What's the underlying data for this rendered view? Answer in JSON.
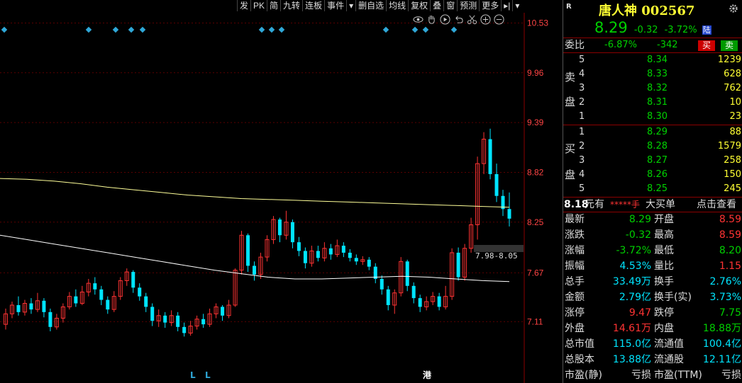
{
  "toolbar": {
    "items": [
      "发",
      "PK",
      "简",
      "九转",
      "连板",
      "事件",
      "▾",
      "删自选",
      "均线",
      "复权",
      "叠",
      "窗",
      "预测",
      "更多",
      "▸|",
      "▾"
    ],
    "icons": [
      "eye-icon",
      "hand-icon",
      "play-icon",
      "undo-icon",
      "scissors-icon",
      "zoom-in-icon",
      "zoom-out-icon"
    ]
  },
  "chart": {
    "y_ticks": [
      "10.53",
      "9.96",
      "9.39",
      "8.82",
      "8.25",
      "7.67",
      "7.11"
    ],
    "range_label": "7.98-8.05",
    "bottom_markers": [
      "L",
      "L",
      "港"
    ]
  },
  "chart_data": {
    "type": "candlestick",
    "ylim": [
      6.7,
      10.55
    ],
    "up_color": "#ff3333",
    "down_color": "#00e5ff",
    "ma_color": "#ffff99",
    "ma2_color": "#ffffff",
    "candles": [
      [
        7.08,
        7.2,
        7.26,
        7.02
      ],
      [
        7.2,
        7.3,
        7.34,
        7.15
      ],
      [
        7.3,
        7.22,
        7.4,
        7.18
      ],
      [
        7.22,
        7.32,
        7.36,
        7.18
      ],
      [
        7.32,
        7.25,
        7.38,
        7.2
      ],
      [
        7.25,
        7.35,
        7.44,
        7.22
      ],
      [
        7.35,
        7.22,
        7.38,
        7.16
      ],
      [
        7.22,
        7.05,
        7.26,
        7.0
      ],
      [
        7.05,
        7.15,
        7.2,
        7.02
      ],
      [
        7.15,
        7.28,
        7.32,
        7.1
      ],
      [
        7.28,
        7.4,
        7.45,
        7.25
      ],
      [
        7.4,
        7.32,
        7.48,
        7.28
      ],
      [
        7.32,
        7.45,
        7.52,
        7.3
      ],
      [
        7.45,
        7.55,
        7.6,
        7.4
      ],
      [
        7.55,
        7.48,
        7.62,
        7.42
      ],
      [
        7.48,
        7.36,
        7.52,
        7.3
      ],
      [
        7.36,
        7.25,
        7.4,
        7.2
      ],
      [
        7.25,
        7.4,
        7.46,
        7.22
      ],
      [
        7.4,
        7.58,
        7.62,
        7.36
      ],
      [
        7.58,
        7.68,
        7.72,
        7.52
      ],
      [
        7.68,
        7.5,
        7.7,
        7.44
      ],
      [
        7.5,
        7.4,
        7.55,
        7.35
      ],
      [
        7.4,
        7.28,
        7.44,
        7.22
      ],
      [
        7.28,
        7.12,
        7.32,
        7.06
      ],
      [
        7.12,
        7.18,
        7.25,
        7.05
      ],
      [
        7.18,
        7.1,
        7.22,
        7.04
      ],
      [
        7.1,
        7.18,
        7.24,
        7.06
      ],
      [
        7.18,
        7.05,
        7.22,
        7.0
      ],
      [
        7.05,
        6.98,
        7.1,
        6.94
      ],
      [
        6.98,
        7.06,
        7.12,
        6.95
      ],
      [
        7.06,
        7.14,
        7.18,
        7.02
      ],
      [
        7.14,
        7.08,
        7.2,
        7.04
      ],
      [
        7.08,
        7.2,
        7.26,
        7.05
      ],
      [
        7.2,
        7.28,
        7.32,
        7.15
      ],
      [
        7.28,
        7.18,
        7.3,
        7.12
      ],
      [
        7.18,
        7.3,
        7.36,
        7.15
      ],
      [
        7.3,
        7.7,
        7.72,
        7.28
      ],
      [
        7.7,
        8.1,
        8.15,
        7.65
      ],
      [
        8.1,
        7.75,
        8.12,
        7.68
      ],
      [
        7.75,
        7.65,
        7.8,
        7.58
      ],
      [
        7.65,
        7.85,
        7.9,
        7.6
      ],
      [
        7.85,
        8.05,
        8.1,
        7.8
      ],
      [
        8.05,
        8.28,
        8.32,
        8.0
      ],
      [
        8.28,
        8.1,
        8.3,
        8.02
      ],
      [
        8.1,
        8.25,
        8.38,
        8.05
      ],
      [
        8.25,
        8.02,
        8.28,
        7.95
      ],
      [
        8.02,
        7.92,
        8.08,
        7.86
      ],
      [
        7.92,
        7.78,
        7.96,
        7.72
      ],
      [
        7.78,
        7.92,
        7.98,
        7.74
      ],
      [
        7.92,
        7.84,
        7.98,
        7.8
      ],
      [
        7.84,
        7.95,
        8.02,
        7.8
      ],
      [
        7.95,
        7.88,
        8.0,
        7.82
      ],
      [
        7.88,
        7.98,
        8.05,
        7.85
      ],
      [
        7.98,
        7.9,
        8.02,
        7.85
      ],
      [
        7.9,
        7.84,
        7.94,
        7.8
      ],
      [
        7.84,
        7.8,
        7.88,
        7.76
      ],
      [
        7.8,
        7.82,
        7.86,
        7.76
      ],
      [
        7.82,
        7.74,
        7.85,
        7.7
      ],
      [
        7.74,
        7.6,
        7.78,
        7.55
      ],
      [
        7.6,
        7.48,
        7.64,
        7.42
      ],
      [
        7.48,
        7.3,
        7.52,
        7.24
      ],
      [
        7.3,
        7.44,
        7.48,
        7.2
      ],
      [
        7.44,
        7.8,
        7.85,
        7.4
      ],
      [
        7.8,
        7.52,
        7.82,
        7.46
      ],
      [
        7.52,
        7.38,
        7.56,
        7.32
      ],
      [
        7.38,
        7.28,
        7.42,
        7.22
      ],
      [
        7.28,
        7.34,
        7.4,
        7.24
      ],
      [
        7.34,
        7.4,
        7.45,
        7.3
      ],
      [
        7.4,
        7.28,
        7.44,
        7.24
      ],
      [
        7.28,
        7.4,
        7.52,
        7.25
      ],
      [
        7.4,
        7.9,
        7.95,
        7.36
      ],
      [
        7.9,
        7.62,
        7.96,
        7.58
      ],
      [
        7.62,
        7.95,
        8.0,
        7.58
      ],
      [
        7.95,
        8.22,
        8.3,
        7.9
      ],
      [
        8.22,
        8.92,
        9.0,
        8.05
      ],
      [
        8.92,
        9.2,
        9.28,
        8.8
      ],
      [
        9.2,
        8.8,
        9.32,
        8.74
      ],
      [
        8.8,
        8.55,
        8.92,
        8.48
      ],
      [
        8.55,
        8.4,
        8.62,
        8.32
      ],
      [
        8.4,
        8.29,
        8.59,
        8.2
      ]
    ],
    "ma_long": [
      8.75,
      8.74,
      8.72,
      8.69,
      8.65,
      8.62,
      8.59,
      8.56,
      8.54,
      8.52,
      8.51,
      8.5,
      8.49,
      8.48,
      8.47,
      8.46,
      8.45,
      8.44,
      8.43,
      8.42
    ],
    "ma_mid": [
      8.1,
      8.05,
      8.0,
      7.95,
      7.9,
      7.85,
      7.8,
      7.75,
      7.7,
      7.66,
      7.62,
      7.6,
      7.6,
      7.61,
      7.62,
      7.63,
      7.62,
      7.6,
      7.58,
      7.57
    ],
    "ticker_markers_x": [
      6,
      125,
      163,
      185,
      201,
      369,
      383,
      397,
      544,
      585,
      600,
      640
    ]
  },
  "panel": {
    "badge": "R",
    "name_code": "唐人神 002567",
    "price": "8.29",
    "change": "-0.32",
    "change_pct": "-3.72%",
    "market_tag": "陆",
    "weibi_label": "委比",
    "weibi_pct": "-6.87%",
    "weibi_diff": "-342",
    "buy_btn": "买",
    "sell_btn": "卖",
    "sell_label": [
      "卖",
      "盘"
    ],
    "buy_label": [
      "买",
      "盘"
    ],
    "asks": [
      {
        "lvl": "5",
        "price": "8.34",
        "vol": "1239"
      },
      {
        "lvl": "4",
        "price": "8.33",
        "vol": "628"
      },
      {
        "lvl": "3",
        "price": "8.32",
        "vol": "762"
      },
      {
        "lvl": "2",
        "price": "8.31",
        "vol": "10"
      },
      {
        "lvl": "1",
        "price": "8.30",
        "vol": "23"
      }
    ],
    "bids": [
      {
        "lvl": "1",
        "price": "8.29",
        "vol": "88"
      },
      {
        "lvl": "2",
        "price": "8.28",
        "vol": "1579"
      },
      {
        "lvl": "3",
        "price": "8.27",
        "vol": "258"
      },
      {
        "lvl": "4",
        "price": "8.26",
        "vol": "150"
      },
      {
        "lvl": "5",
        "price": "8.25",
        "vol": "245"
      }
    ],
    "bigorder": {
      "price": "8.18",
      "unit": "元有",
      "stars": "*****手",
      "label": "大买单",
      "link": "点击查看"
    },
    "stats": [
      {
        "l1": "最新",
        "v1": "8.29",
        "c1": "green",
        "l2": "开盘",
        "v2": "8.59",
        "c2": "red"
      },
      {
        "l1": "涨跌",
        "v1": "-0.32",
        "c1": "green",
        "l2": "最高",
        "v2": "8.59",
        "c2": "red"
      },
      {
        "l1": "涨幅",
        "v1": "-3.72%",
        "c1": "green",
        "l2": "最低",
        "v2": "8.20",
        "c2": "green"
      },
      {
        "l1": "振幅",
        "v1": "4.53%",
        "c1": "cyan",
        "l2": "量比",
        "v2": "1.15",
        "c2": "red"
      },
      {
        "l1": "总手",
        "v1": "33.49万",
        "c1": "cyan",
        "l2": "换手",
        "v2": "2.76%",
        "c2": "cyan"
      },
      {
        "l1": "金额",
        "v1": "2.79亿",
        "c1": "cyan",
        "l2": "换手(实)",
        "v2": "3.73%",
        "c2": "cyan"
      },
      {
        "l1": "涨停",
        "v1": "9.47",
        "c1": "red",
        "l2": "跌停",
        "v2": "7.75",
        "c2": "green"
      },
      {
        "l1": "外盘",
        "v1": "14.61万",
        "c1": "red",
        "l2": "内盘",
        "v2": "18.88万",
        "c2": "green"
      },
      {
        "l1": "总市值",
        "v1": "115.0亿",
        "c1": "cyan",
        "l2": "流通值",
        "v2": "100.4亿",
        "c2": "cyan"
      },
      {
        "l1": "总股本",
        "v1": "13.88亿",
        "c1": "cyan",
        "l2": "流通股",
        "v2": "12.11亿",
        "c2": "cyan"
      },
      {
        "l1": "市盈(静)",
        "v1": "亏损",
        "c1": "white",
        "l2": "市盈(TTM)",
        "v2": "亏损",
        "c2": "white"
      }
    ]
  }
}
